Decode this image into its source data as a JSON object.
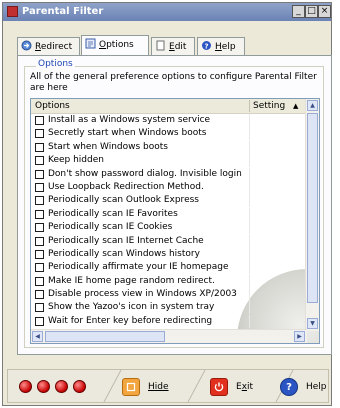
{
  "window": {
    "title": "Parental Filter",
    "controls": [
      "_",
      "□",
      "×"
    ]
  },
  "tabs": [
    {
      "label": "Redirect",
      "underline": "R",
      "rest": "edirect",
      "icon": "redirect-icon",
      "active": false
    },
    {
      "label": "Options",
      "underline": "O",
      "rest": "ptions",
      "icon": "options-icon",
      "active": true
    },
    {
      "label": "Edit",
      "underline": "E",
      "rest": "dit",
      "icon": "edit-icon",
      "active": false
    },
    {
      "label": "Help",
      "underline": "H",
      "rest": "elp",
      "icon": "help-icon",
      "active": false
    }
  ],
  "options_group": {
    "label": "Options",
    "description": "All of the general preference options to configure Parental Filter are here"
  },
  "list": {
    "columns": [
      "Options",
      "Setting"
    ],
    "rows": [
      "Install as a Windows system service",
      "Secretly start when Windows boots",
      "Start when Windows boots",
      "Keep hidden",
      "Don't show password dialog. Invisible login",
      "Use Loopback Redirection Method.",
      "Periodically scan Outlook Express",
      "Periodically scan IE Favorites",
      "Periodically scan IE Cookies",
      "Periodically scan IE Internet Cache",
      "Periodically scan Windows history",
      "Periodically affirmate your IE homepage",
      "Make IE home page random redirect.",
      "Disable process view in Windows XP/2003",
      "Show the Yazoo's icon in system tray",
      "Wait for Enter key before redirecting"
    ]
  },
  "bottom": {
    "hide_label": "Hide",
    "hide_ul": "H",
    "hide_rest": "ide",
    "exit_label": "Exit",
    "exit_pre": "E",
    "exit_ul": "x",
    "exit_post": "it",
    "help_label": "Help"
  },
  "colors": {
    "accent": "#1f47b4",
    "dot": "#c70000"
  }
}
